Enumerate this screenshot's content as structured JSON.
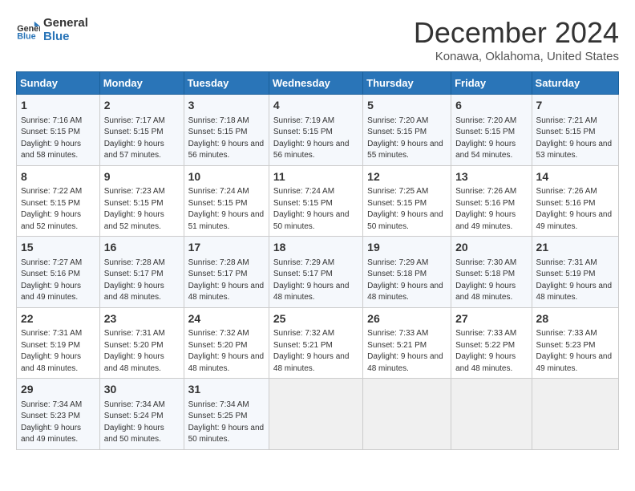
{
  "logo": {
    "line1": "General",
    "line2": "Blue"
  },
  "title": "December 2024",
  "subtitle": "Konawa, Oklahoma, United States",
  "days_of_week": [
    "Sunday",
    "Monday",
    "Tuesday",
    "Wednesday",
    "Thursday",
    "Friday",
    "Saturday"
  ],
  "weeks": [
    [
      {
        "day": "1",
        "sunrise": "7:16 AM",
        "sunset": "5:15 PM",
        "daylight": "9 hours and 58 minutes."
      },
      {
        "day": "2",
        "sunrise": "7:17 AM",
        "sunset": "5:15 PM",
        "daylight": "9 hours and 57 minutes."
      },
      {
        "day": "3",
        "sunrise": "7:18 AM",
        "sunset": "5:15 PM",
        "daylight": "9 hours and 56 minutes."
      },
      {
        "day": "4",
        "sunrise": "7:19 AM",
        "sunset": "5:15 PM",
        "daylight": "9 hours and 56 minutes."
      },
      {
        "day": "5",
        "sunrise": "7:20 AM",
        "sunset": "5:15 PM",
        "daylight": "9 hours and 55 minutes."
      },
      {
        "day": "6",
        "sunrise": "7:20 AM",
        "sunset": "5:15 PM",
        "daylight": "9 hours and 54 minutes."
      },
      {
        "day": "7",
        "sunrise": "7:21 AM",
        "sunset": "5:15 PM",
        "daylight": "9 hours and 53 minutes."
      }
    ],
    [
      {
        "day": "8",
        "sunrise": "7:22 AM",
        "sunset": "5:15 PM",
        "daylight": "9 hours and 52 minutes."
      },
      {
        "day": "9",
        "sunrise": "7:23 AM",
        "sunset": "5:15 PM",
        "daylight": "9 hours and 52 minutes."
      },
      {
        "day": "10",
        "sunrise": "7:24 AM",
        "sunset": "5:15 PM",
        "daylight": "9 hours and 51 minutes."
      },
      {
        "day": "11",
        "sunrise": "7:24 AM",
        "sunset": "5:15 PM",
        "daylight": "9 hours and 50 minutes."
      },
      {
        "day": "12",
        "sunrise": "7:25 AM",
        "sunset": "5:15 PM",
        "daylight": "9 hours and 50 minutes."
      },
      {
        "day": "13",
        "sunrise": "7:26 AM",
        "sunset": "5:16 PM",
        "daylight": "9 hours and 49 minutes."
      },
      {
        "day": "14",
        "sunrise": "7:26 AM",
        "sunset": "5:16 PM",
        "daylight": "9 hours and 49 minutes."
      }
    ],
    [
      {
        "day": "15",
        "sunrise": "7:27 AM",
        "sunset": "5:16 PM",
        "daylight": "9 hours and 49 minutes."
      },
      {
        "day": "16",
        "sunrise": "7:28 AM",
        "sunset": "5:17 PM",
        "daylight": "9 hours and 48 minutes."
      },
      {
        "day": "17",
        "sunrise": "7:28 AM",
        "sunset": "5:17 PM",
        "daylight": "9 hours and 48 minutes."
      },
      {
        "day": "18",
        "sunrise": "7:29 AM",
        "sunset": "5:17 PM",
        "daylight": "9 hours and 48 minutes."
      },
      {
        "day": "19",
        "sunrise": "7:29 AM",
        "sunset": "5:18 PM",
        "daylight": "9 hours and 48 minutes."
      },
      {
        "day": "20",
        "sunrise": "7:30 AM",
        "sunset": "5:18 PM",
        "daylight": "9 hours and 48 minutes."
      },
      {
        "day": "21",
        "sunrise": "7:31 AM",
        "sunset": "5:19 PM",
        "daylight": "9 hours and 48 minutes."
      }
    ],
    [
      {
        "day": "22",
        "sunrise": "7:31 AM",
        "sunset": "5:19 PM",
        "daylight": "9 hours and 48 minutes."
      },
      {
        "day": "23",
        "sunrise": "7:31 AM",
        "sunset": "5:20 PM",
        "daylight": "9 hours and 48 minutes."
      },
      {
        "day": "24",
        "sunrise": "7:32 AM",
        "sunset": "5:20 PM",
        "daylight": "9 hours and 48 minutes."
      },
      {
        "day": "25",
        "sunrise": "7:32 AM",
        "sunset": "5:21 PM",
        "daylight": "9 hours and 48 minutes."
      },
      {
        "day": "26",
        "sunrise": "7:33 AM",
        "sunset": "5:21 PM",
        "daylight": "9 hours and 48 minutes."
      },
      {
        "day": "27",
        "sunrise": "7:33 AM",
        "sunset": "5:22 PM",
        "daylight": "9 hours and 48 minutes."
      },
      {
        "day": "28",
        "sunrise": "7:33 AM",
        "sunset": "5:23 PM",
        "daylight": "9 hours and 49 minutes."
      }
    ],
    [
      {
        "day": "29",
        "sunrise": "7:34 AM",
        "sunset": "5:23 PM",
        "daylight": "9 hours and 49 minutes."
      },
      {
        "day": "30",
        "sunrise": "7:34 AM",
        "sunset": "5:24 PM",
        "daylight": "9 hours and 50 minutes."
      },
      {
        "day": "31",
        "sunrise": "7:34 AM",
        "sunset": "5:25 PM",
        "daylight": "9 hours and 50 minutes."
      },
      null,
      null,
      null,
      null
    ]
  ],
  "labels": {
    "sunrise": "Sunrise:",
    "sunset": "Sunset:",
    "daylight": "Daylight:"
  }
}
